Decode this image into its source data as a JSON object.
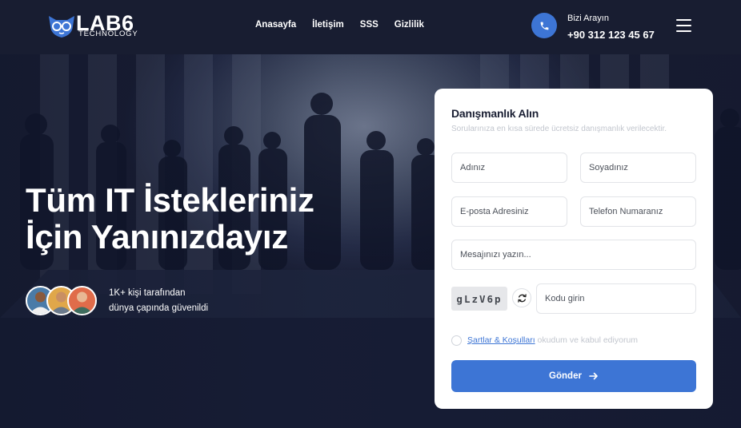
{
  "brand": {
    "name": "LAB6",
    "tagline": "TECHNOLOGY",
    "logo_icon": "fox-glasses-icon"
  },
  "nav": {
    "items": [
      {
        "label": "Anasayfa"
      },
      {
        "label": "İletişim"
      },
      {
        "label": "SSS"
      },
      {
        "label": "Gizlilik"
      }
    ]
  },
  "contact": {
    "label": "Bizi Arayın",
    "phone": "+90 312 123 45 67",
    "icon": "phone-icon"
  },
  "menu": {
    "icon": "hamburger-menu-icon"
  },
  "hero": {
    "title_line1": "Tüm IT İstekleriniz",
    "title_line2": "İçin Yanınızdayız",
    "trust_line1": "1K+ kişi tarafından",
    "trust_line2": "dünya çapında güvenildi"
  },
  "form": {
    "title": "Danışmanlık Alın",
    "subtitle": "Sorularınıza en kısa sürede ücretsiz danışmanlık verilecektir.",
    "first_name_placeholder": "Adınız",
    "last_name_placeholder": "Soyadınız",
    "email_placeholder": "E-posta Adresiniz",
    "phone_placeholder": "Telefon Numaranız",
    "message_placeholder": "Mesajınızı yazın...",
    "captcha_code": "gLzV6p",
    "captcha_placeholder": "Kodu girin",
    "terms_link": "Şartlar & Koşulları",
    "terms_text": "okudum ve kabul ediyorum",
    "submit_label": "Gönder"
  },
  "colors": {
    "accent": "#3d75d5",
    "header_bg": "#181d31",
    "card_bg": "#ffffff"
  }
}
